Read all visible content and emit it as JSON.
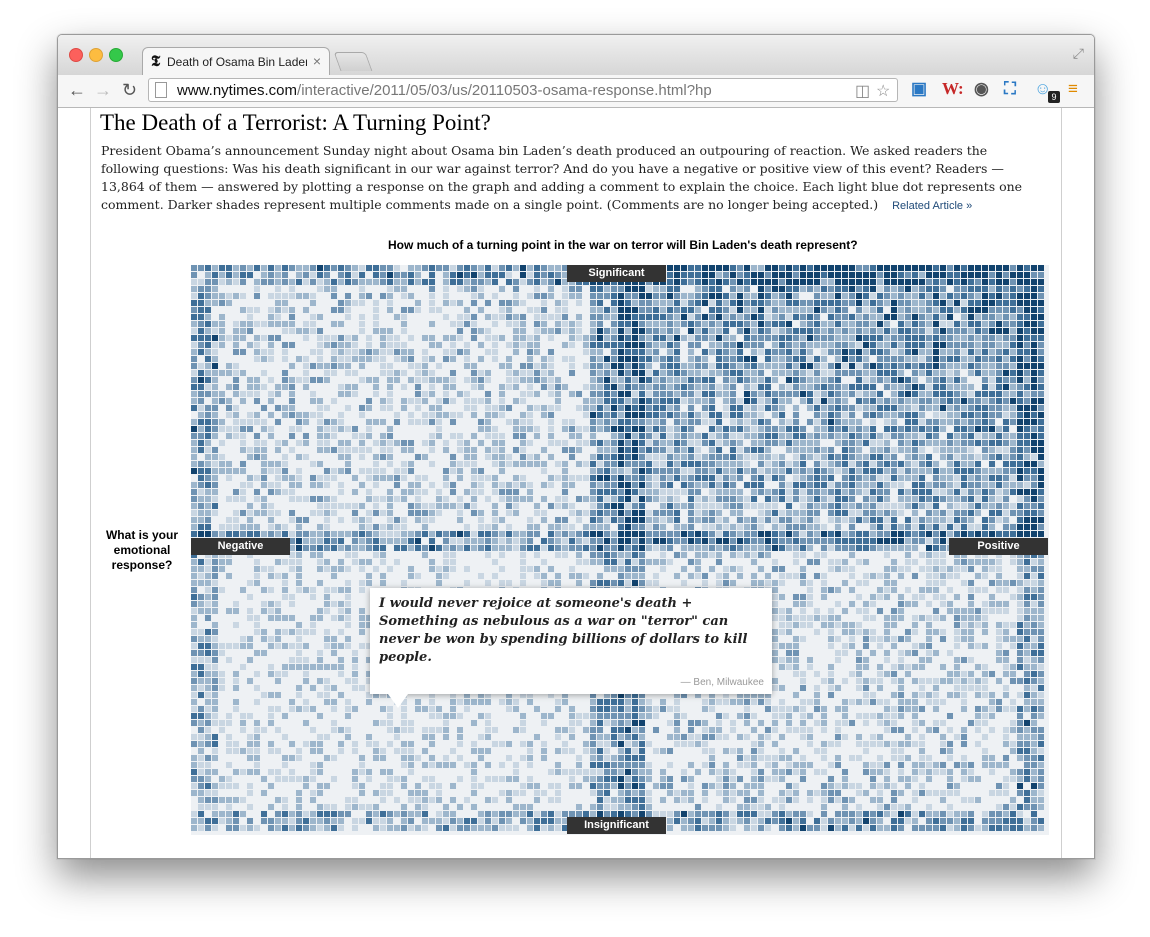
{
  "browser": {
    "tab_title": "Death of Osama Bin Laden",
    "tab_close": "×",
    "tab_icon": "𝕿",
    "url_host": "www.nytimes.com",
    "url_path": "/interactive/2011/05/03/us/20110503-osama-response.html?hp",
    "extension_badge": "9",
    "icons": [
      "back-arrow-icon",
      "forward-arrow-icon",
      "reload-icon",
      "page-icon",
      "reader-icon",
      "bookmark-star-icon",
      "screenshot-extension-icon",
      "w-extension-icon",
      "camera-extension-icon",
      "capture-extension-icon",
      "ghost-extension-icon",
      "menu-icon"
    ]
  },
  "article": {
    "headline": "The Death of a Terrorist: A Turning Point?",
    "intro": "President Obama’s announcement Sunday night about Osama bin Laden’s death produced an outpouring of reaction. We asked readers the following questions: Was his death significant in our war against terror? And do you have a negative or positive view of this event? Readers — 13,864 of them — answered by plotting a response on the graph and adding a comment to explain the choice. Each light blue dot represents one comment. Darker shades represent multiple comments made on a single point. (Comments are no longer being accepted.)",
    "related_link": "Related Article »"
  },
  "chart": {
    "question": "How much of a turning point in the war on terror will Bin Laden's death represent?",
    "y_top": "Significant",
    "y_bottom": "Insignificant",
    "x_left": "Negative",
    "x_right": "Positive",
    "emotion_question": "What is your emotional response?",
    "colors": [
      "#eef1f4",
      "#c9d6e2",
      "#9db6cc",
      "#6f93b3",
      "#3f6f98",
      "#12436e"
    ]
  },
  "comment": {
    "text": "I would never rejoice at someone's death + Something as nebulous as a war on \"terror\" can never be won by spending billions of dollars to kill people.",
    "attribution": "— Ben, Milwaukee"
  }
}
